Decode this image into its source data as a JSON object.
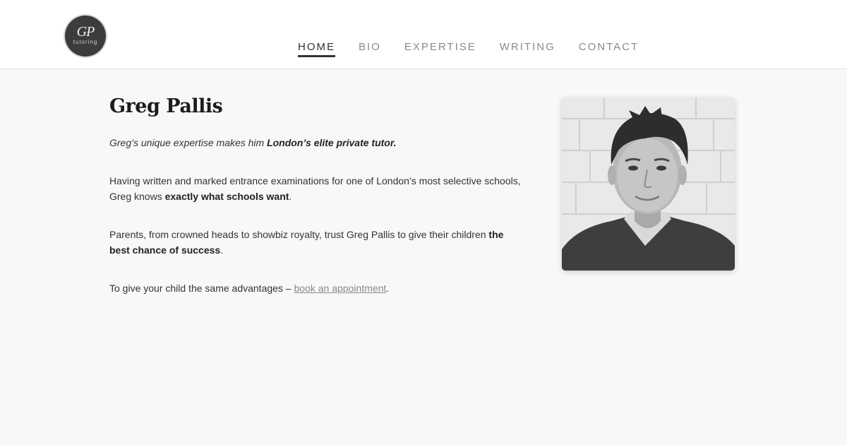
{
  "logo": {
    "monogram": "GP",
    "word": "tutoring"
  },
  "nav": {
    "items": [
      {
        "label": "HOME",
        "active": true
      },
      {
        "label": "BIO",
        "active": false
      },
      {
        "label": "EXPERTISE",
        "active": false
      },
      {
        "label": "WRITING",
        "active": false
      },
      {
        "label": "CONTACT",
        "active": false
      }
    ]
  },
  "main": {
    "title": "Greg Pallis",
    "intro_prefix": "Greg’s unique expertise makes him ",
    "intro_bold": "London’s elite private tutor.",
    "p1_prefix": "Having written and marked entrance examinations for one of London’s most selective schools, Greg knows ",
    "p1_bold": "exactly what schools want",
    "p1_suffix": ".",
    "p2_prefix": "Parents, from crowned heads to showbiz royalty, trust Greg Pallis to give their children ",
    "p2_bold": "the best chance of success",
    "p2_suffix": ".",
    "p3_prefix": "To give your child the same advantages – ",
    "p3_link": "book an appointment",
    "p3_suffix": "."
  },
  "photo": {
    "icon": "portrait-photo"
  }
}
